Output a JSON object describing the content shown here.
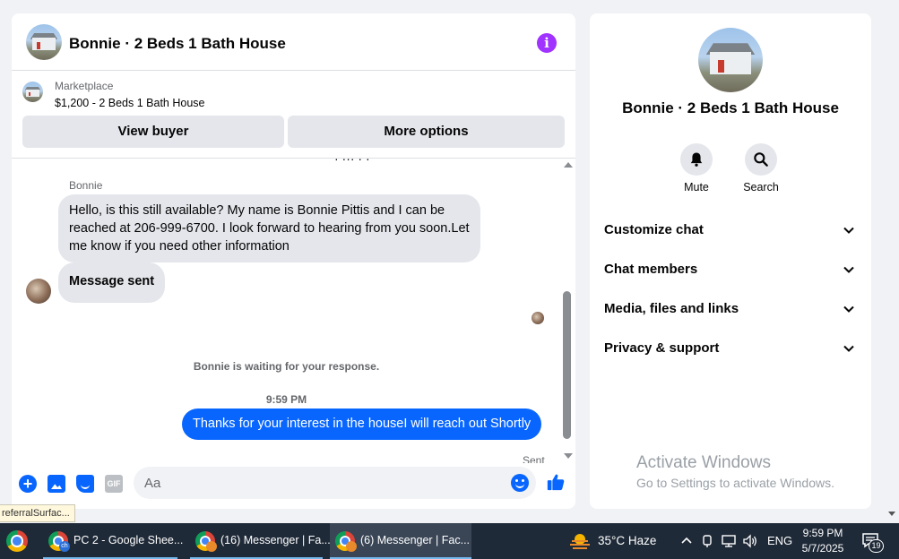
{
  "chat": {
    "title": "Bonnie · 2 Beds 1 Bath House",
    "marketplace": {
      "label": "Marketplace",
      "price_title": "$1,200 - 2 Beds 1 Bath House",
      "view_buyer": "View buyer",
      "more_options": "More options"
    },
    "messages": {
      "cut_top_text": "· ··· · ·",
      "sender_name": "Bonnie",
      "incoming_long": "Hello, is this still available? My name is Bonnie Pittis and I can be reached at 206-999-6700. I look forward to hearing from you soon.Let me know if you need other information",
      "incoming_short": "Message sent",
      "waiting_notice": "Bonnie is waiting for your response.",
      "timestamp": "9:59 PM",
      "outgoing": "Thanks for your interest in the houseI will reach out Shortly",
      "status": "Sent"
    },
    "composer": {
      "placeholder": "Aa",
      "gif_label": "GIF"
    }
  },
  "info": {
    "title": "Bonnie · 2 Beds 1 Bath House",
    "actions": {
      "mute": "Mute",
      "search": "Search"
    },
    "sections": [
      "Customize chat",
      "Chat members",
      "Media, files and links",
      "Privacy & support"
    ]
  },
  "watermark": {
    "title": "Activate Windows",
    "subtitle": "Go to Settings to activate Windows."
  },
  "tooltip": "referralSurfac...",
  "taskbar": {
    "tasks": [
      {
        "label": "PC 2 - Google Shee...",
        "badge": "ch"
      },
      {
        "label": "(16) Messenger | Fa...",
        "badge": ""
      },
      {
        "label": "(6) Messenger | Fac...",
        "badge": ""
      }
    ],
    "weather": "35°C  Haze",
    "language": "ENG",
    "time": "9:59 PM",
    "date": "5/7/2025",
    "notifications": "19"
  },
  "colors": {
    "accent": "#0866ff",
    "info_icon": "#a033ff",
    "taskbar": "#1f2a38"
  }
}
